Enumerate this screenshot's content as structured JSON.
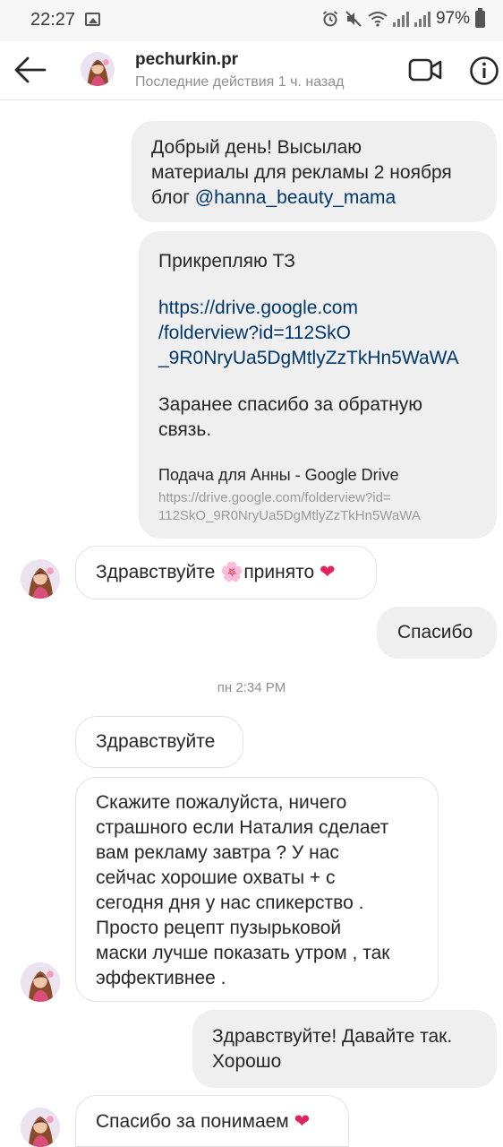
{
  "status_bar": {
    "time": "22:27",
    "battery": "97%"
  },
  "header": {
    "username": "pechurkin.pr",
    "activity": "Последние действия 1 ч. назад"
  },
  "messages": [
    {
      "id": "m1",
      "direction": "outgoing",
      "lines": [
        "Добрый день! Высылаю",
        "материалы для рекламы 2 ноября"
      ],
      "last_line_prefix": "блог ",
      "mention": "@hanna_beauty_mama"
    },
    {
      "id": "m2",
      "direction": "outgoing",
      "intro": "Прикрепляю ТЗ",
      "link_lines": [
        "https://drive.google.com",
        "/folderview?id=112SkO",
        "_9R0NryUa5DgMtlyZzTkHn5WaWA"
      ],
      "thanks_lines": [
        "Заранее спасибо за обратную",
        "связь."
      ],
      "preview_title": "Подача для Анны - Google Drive",
      "preview_url_lines": [
        "https://drive.google.com/folderview?id=",
        "112SkO_9R0NryUa5DgMtlyZzTkHn5WaWA"
      ]
    },
    {
      "id": "m3",
      "direction": "incoming",
      "text_a": "Здравствуйте ",
      "emoji_a": "🌸",
      "text_b": "принято ",
      "emoji_b": "❤"
    },
    {
      "id": "m4",
      "direction": "outgoing",
      "text": "Спасибо"
    },
    {
      "id": "m5",
      "direction": "incoming",
      "text": "Здравствуйте"
    },
    {
      "id": "m6",
      "direction": "incoming",
      "lines": [
        "Скажите пожалуйста, ничего",
        "страшного если Наталия сделает",
        "вам рекламу завтра ? У нас",
        "сейчас хорошие охваты + с",
        "сегодня дня у нас спикерство .",
        "Просто рецепт пузырьковой",
        "маски лучше показать утром , так",
        "эффективнее ."
      ]
    },
    {
      "id": "m7",
      "direction": "outgoing",
      "lines": [
        "Здравствуйте! Давайте так.",
        "Хорошо"
      ]
    },
    {
      "id": "m8",
      "direction": "incoming",
      "text": "Спасибо за понимаем ",
      "emoji": "❤"
    }
  ],
  "timestamp": "пн 2:34 PM",
  "colors": {
    "outgoing_bubble": "#efefef",
    "incoming_border": "#e3e3e3",
    "link": "#00376b",
    "secondary_text": "#8e8e8e"
  },
  "icons": {
    "back": "arrow-left-icon",
    "video": "video-camera-icon",
    "info": "info-icon",
    "alarm": "alarm-icon",
    "mute": "mute-icon",
    "wifi": "wifi-icon",
    "signal": "signal-icon",
    "battery": "battery-icon",
    "gallery": "image-icon"
  }
}
